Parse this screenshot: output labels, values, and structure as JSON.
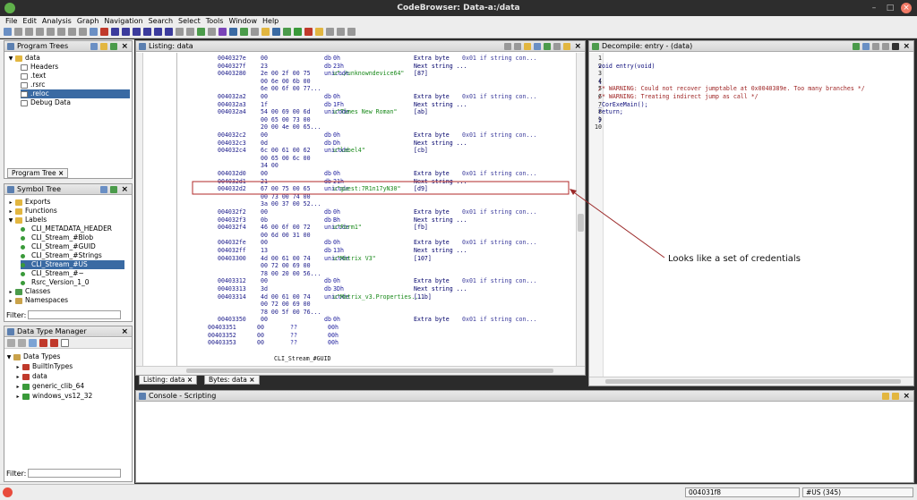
{
  "window": {
    "title": "CodeBrowser: Data-a:/data"
  },
  "menu": [
    "File",
    "Edit",
    "Analysis",
    "Graph",
    "Navigation",
    "Search",
    "Select",
    "Tools",
    "Window",
    "Help"
  ],
  "program_trees": {
    "title": "Program Trees",
    "root": "data",
    "items": [
      "Headers",
      ".text",
      ".rsrc",
      ".reloc",
      "Debug Data"
    ],
    "selected_index": 3,
    "tab": "Program Tree"
  },
  "symbol_tree": {
    "title": "Symbol Tree",
    "items": [
      {
        "label": "Exports",
        "level": 1,
        "kind": "folder"
      },
      {
        "label": "Functions",
        "level": 1,
        "kind": "folder"
      },
      {
        "label": "Labels",
        "level": 1,
        "kind": "folder-open"
      },
      {
        "label": "CLI_METADATA_HEADER",
        "level": 2,
        "kind": "label"
      },
      {
        "label": "CLI_Stream_#Blob",
        "level": 2,
        "kind": "label"
      },
      {
        "label": "CLI_Stream_#GUID",
        "level": 2,
        "kind": "label"
      },
      {
        "label": "CLI_Stream_#Strings",
        "level": 2,
        "kind": "label"
      },
      {
        "label": "CLI_Stream_#US",
        "level": 2,
        "kind": "label",
        "selected": true
      },
      {
        "label": "CLI_Stream_#~",
        "level": 2,
        "kind": "label"
      },
      {
        "label": "Rsrc_Version_1_0",
        "level": 2,
        "kind": "label"
      },
      {
        "label": "Classes",
        "level": 1,
        "kind": "classes"
      },
      {
        "label": "Namespaces",
        "level": 1,
        "kind": "namespaces"
      }
    ],
    "filter_label": "Filter:"
  },
  "data_type_manager": {
    "title": "Data Type Manager",
    "root": "Data Types",
    "items": [
      "BuiltInTypes",
      "data",
      "generic_clib_64",
      "windows_vs12_32"
    ],
    "filter_label": "Filter:"
  },
  "listing": {
    "title": "Listing:  data",
    "rows": [
      {
        "addr": "0040327e",
        "bytes": "00",
        "mn": "db",
        "op": "0h",
        "cm": "Extra byte",
        "xr": "0x01 if string con..."
      },
      {
        "addr": "0040327f",
        "bytes": "23",
        "mn": "db",
        "op": "23h",
        "cm": "Next string ...",
        "xr": ""
      },
      {
        "addr": "00403280",
        "bytes": "2e 00 2f 00 75",
        "mn": "unicode",
        "op": "u\"./unknowndevice64\"",
        "cm": "[87]",
        "xr": ""
      },
      {
        "addr": "",
        "bytes": "00 6e 00 6b 00",
        "mn": "",
        "op": "",
        "cm": "",
        "xr": ""
      },
      {
        "addr": "",
        "bytes": "6e 00 6f 00 77...",
        "mn": "",
        "op": "",
        "cm": "",
        "xr": ""
      },
      {
        "addr": "004032a2",
        "bytes": "00",
        "mn": "db",
        "op": "0h",
        "cm": "Extra byte",
        "xr": "0x01 if string con..."
      },
      {
        "addr": "004032a3",
        "bytes": "1f",
        "mn": "db",
        "op": "1Fh",
        "cm": "Next string ...",
        "xr": ""
      },
      {
        "addr": "004032a4",
        "bytes": "54 00 69 00 6d",
        "mn": "unicode",
        "op": "u\"Times New Roman\"",
        "cm": "[ab]",
        "xr": ""
      },
      {
        "addr": "",
        "bytes": "00 65 00 73 00",
        "mn": "",
        "op": "",
        "cm": "",
        "xr": ""
      },
      {
        "addr": "",
        "bytes": "20 00 4e 00 65...",
        "mn": "",
        "op": "",
        "cm": "",
        "xr": ""
      },
      {
        "addr": "004032c2",
        "bytes": "00",
        "mn": "db",
        "op": "0h",
        "cm": "Extra byte",
        "xr": "0x01 if string con..."
      },
      {
        "addr": "004032c3",
        "bytes": "0d",
        "mn": "db",
        "op": "Dh",
        "cm": "Next string ...",
        "xr": ""
      },
      {
        "addr": "004032c4",
        "bytes": "6c 00 61 00 62",
        "mn": "unicode",
        "op": "u\"label4\"",
        "cm": "[cb]",
        "xr": ""
      },
      {
        "addr": "",
        "bytes": "00 65 00 6c 00",
        "mn": "",
        "op": "",
        "cm": "",
        "xr": ""
      },
      {
        "addr": "",
        "bytes": "34 00",
        "mn": "",
        "op": "",
        "cm": "",
        "xr": ""
      },
      {
        "addr": "004032d0",
        "bytes": "00",
        "mn": "db",
        "op": "0h",
        "cm": "Extra byte",
        "xr": "0x01 if string con..."
      },
      {
        "addr": "004032d1",
        "bytes": "21",
        "mn": "db",
        "op": "21h",
        "cm": "Next string ...",
        "xr": ""
      },
      {
        "addr": "004032d2",
        "bytes": "67 00 75 00 65",
        "mn": "unicode",
        "op": "u\"guest:7R1n17yN30\"",
        "cm": "[d9]",
        "xr": "",
        "hl": true
      },
      {
        "addr": "",
        "bytes": "00 73 00 74 00",
        "mn": "",
        "op": "",
        "cm": "",
        "xr": ""
      },
      {
        "addr": "",
        "bytes": "3a 00 37 00 52...",
        "mn": "",
        "op": "",
        "cm": "",
        "xr": ""
      },
      {
        "addr": "004032f2",
        "bytes": "00",
        "mn": "db",
        "op": "0h",
        "cm": "Extra byte",
        "xr": "0x01 if string con..."
      },
      {
        "addr": "004032f3",
        "bytes": "0b",
        "mn": "db",
        "op": "Bh",
        "cm": "Next string ...",
        "xr": ""
      },
      {
        "addr": "004032f4",
        "bytes": "46 00 6f 00 72",
        "mn": "unicode",
        "op": "u\"Form1\"",
        "cm": "[fb]",
        "xr": ""
      },
      {
        "addr": "",
        "bytes": "00 6d 00 31 00",
        "mn": "",
        "op": "",
        "cm": "",
        "xr": ""
      },
      {
        "addr": "004032fe",
        "bytes": "00",
        "mn": "db",
        "op": "0h",
        "cm": "Extra byte",
        "xr": "0x01 if string con..."
      },
      {
        "addr": "004032ff",
        "bytes": "13",
        "mn": "db",
        "op": "13h",
        "cm": "Next string ...",
        "xr": ""
      },
      {
        "addr": "00403300",
        "bytes": "4d 00 61 00 74",
        "mn": "unicode",
        "op": "u\"Matrix V3\"",
        "cm": "[107]",
        "xr": ""
      },
      {
        "addr": "",
        "bytes": "00 72 00 69 00",
        "mn": "",
        "op": "",
        "cm": "",
        "xr": ""
      },
      {
        "addr": "",
        "bytes": "78 00 20 00 56...",
        "mn": "",
        "op": "",
        "cm": "",
        "xr": ""
      },
      {
        "addr": "00403312",
        "bytes": "00",
        "mn": "db",
        "op": "0h",
        "cm": "Extra byte",
        "xr": "0x01 if string con..."
      },
      {
        "addr": "00403313",
        "bytes": "3d",
        "mn": "db",
        "op": "3Dh",
        "cm": "Next string ...",
        "xr": ""
      },
      {
        "addr": "00403314",
        "bytes": "4d 00 61 00 74",
        "mn": "unicode",
        "op": "u\"Matrix_v3.Properties...",
        "cm": "[11b]",
        "xr": ""
      },
      {
        "addr": "",
        "bytes": "00 72 00 69 00",
        "mn": "",
        "op": "",
        "cm": "",
        "xr": ""
      },
      {
        "addr": "",
        "bytes": "78 00 5f 00 76...",
        "mn": "",
        "op": "",
        "cm": "",
        "xr": ""
      },
      {
        "addr": "00403350",
        "bytes": "00",
        "mn": "db",
        "op": "0h",
        "cm": "Extra byte",
        "xr": "0x01 if string con..."
      },
      {
        "addr": "00403351",
        "bytes": "00",
        "mn": "??",
        "op": "00h",
        "cm": "",
        "xr": "",
        "outer": true
      },
      {
        "addr": "00403352",
        "bytes": "00",
        "mn": "??",
        "op": "00h",
        "cm": "",
        "xr": "",
        "outer": true
      },
      {
        "addr": "00403353",
        "bytes": "00",
        "mn": "??",
        "op": "00h",
        "cm": "",
        "xr": "",
        "outer": true
      }
    ],
    "footer_label": "CLI_Stream_#GUID",
    "tabs": [
      "Listing:  data",
      "Bytes: data"
    ]
  },
  "decompile": {
    "title": "Decompile: entry - (data)",
    "lines": [
      "",
      "void entry(void)",
      "",
      "{",
      "                    /* WARNING: Could not recover jumptable at 0x0040389e. Too many branches */",
      "                    /* WARNING: Treating indirect jump as call */",
      "  _CorExeMain();",
      "  return;",
      "}",
      ""
    ]
  },
  "console": {
    "title": "Console - Scripting"
  },
  "annotation": {
    "text": "Looks like a set of credentials"
  },
  "status": {
    "address": "004031f8",
    "location": "#US (345)"
  },
  "colors": {
    "selection": "#3a6aa3",
    "highlight_box": "#b12828",
    "arrow": "#9c2a2a"
  }
}
